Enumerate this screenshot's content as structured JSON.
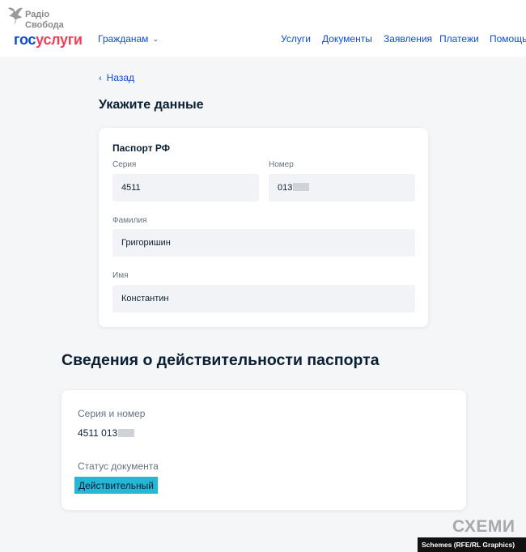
{
  "watermark_top": {
    "line1": "Радіо",
    "line2": "Свобода"
  },
  "header": {
    "logo": {
      "part1": "гос",
      "part2": "услуги"
    },
    "citizens_menu": "Гражданам",
    "nav": [
      "Услуги",
      "Документы",
      "Заявления",
      "Платежи",
      "Помощь"
    ]
  },
  "back_label": "Назад",
  "page_title": "Укажите данные",
  "passport": {
    "title": "Паспорт РФ",
    "series_label": "Серия",
    "series_value": "4511",
    "number_label": "Номер",
    "number_value": "013",
    "surname_label": "Фамилия",
    "surname_value": "Григоришин",
    "name_label": "Имя",
    "name_value": "Константин"
  },
  "validity": {
    "title": "Сведения о действительности паспорта",
    "series_number_label": "Серия и номер",
    "series_number_value": "4511 013",
    "status_label": "Статус документа",
    "status_value": "Действительный"
  },
  "watermark_bottom": {
    "brand": "СХЕМИ",
    "credit": "Schemes (RFE/RL Graphics)"
  },
  "colors": {
    "link": "#0d4cd3",
    "brand_red": "#ee3f58",
    "status_highlight": "#25b7d6"
  }
}
